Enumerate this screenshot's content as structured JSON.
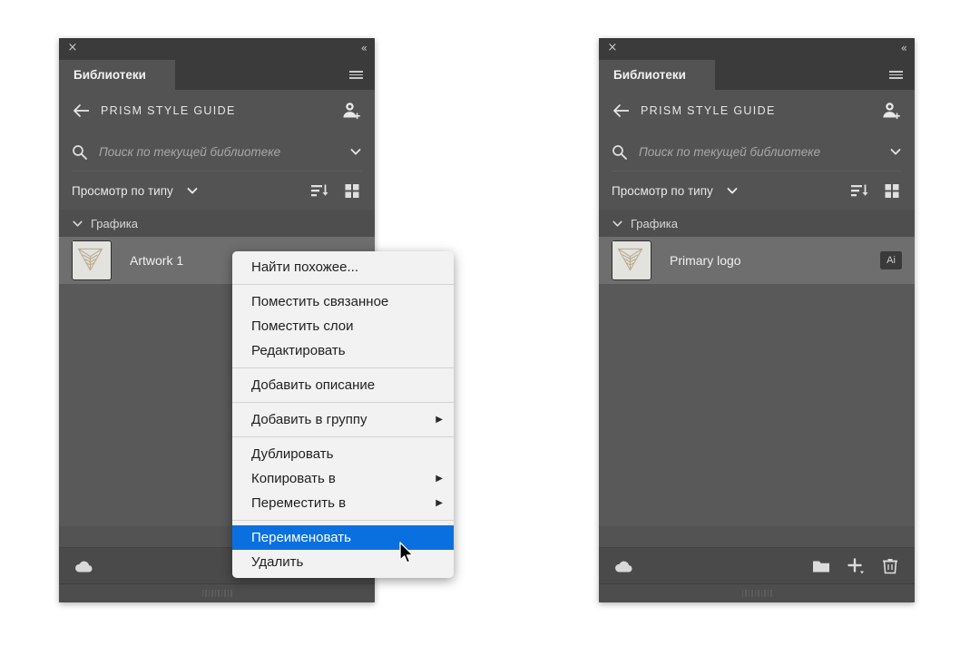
{
  "panels": {
    "left": {
      "titlebar": {
        "close": "×",
        "collapse": "«"
      },
      "tab": {
        "label": "Библиотеки",
        "menu_icon": "hamburger-icon"
      },
      "breadcrumb": {
        "back_icon": "back-arrow-icon",
        "title": "PRISM STYLE GUIDE",
        "invite_icon": "invite-person-icon"
      },
      "search": {
        "icon": "search-icon",
        "value": "",
        "placeholder": "Поиск по текущей библиотеке",
        "caret_icon": "chevron-down-icon"
      },
      "filter": {
        "label": "Просмотр по типу",
        "caret_icon": "chevron-down-icon",
        "sort_icon": "sort-descending-icon",
        "grid_icon": "grid-view-icon"
      },
      "group": {
        "label": "Графика",
        "chevron_icon": "chevron-down-icon"
      },
      "asset": {
        "name": "Artwork 1",
        "thumb_icon": "logo-thumbnail",
        "badge": ""
      },
      "bottom": {
        "cloud_icon": "cloud-sync-icon",
        "folder_icon": "new-folder-icon",
        "add_icon": "add-element-icon",
        "trash_icon": "delete-icon"
      }
    },
    "right": {
      "titlebar": {
        "close": "×",
        "collapse": "«"
      },
      "tab": {
        "label": "Библиотеки",
        "menu_icon": "hamburger-icon"
      },
      "breadcrumb": {
        "back_icon": "back-arrow-icon",
        "title": "PRISM STYLE GUIDE",
        "invite_icon": "invite-person-icon"
      },
      "search": {
        "icon": "search-icon",
        "value": "",
        "placeholder": "Поиск по текущей библиотеке",
        "caret_icon": "chevron-down-icon"
      },
      "filter": {
        "label": "Просмотр по типу",
        "caret_icon": "chevron-down-icon",
        "sort_icon": "sort-descending-icon",
        "grid_icon": "grid-view-icon"
      },
      "group": {
        "label": "Графика",
        "chevron_icon": "chevron-down-icon"
      },
      "asset": {
        "name": "Primary logo",
        "thumb_icon": "logo-thumbnail",
        "badge": "Ai"
      },
      "bottom": {
        "cloud_icon": "cloud-sync-icon",
        "folder_icon": "new-folder-icon",
        "add_icon": "add-element-icon",
        "trash_icon": "delete-icon"
      }
    }
  },
  "context_menu": {
    "items": [
      {
        "label": "Найти похожее...",
        "submenu": false,
        "highlighted": false
      },
      {
        "label": "Поместить связанное",
        "submenu": false,
        "highlighted": false
      },
      {
        "label": "Поместить слои",
        "submenu": false,
        "highlighted": false
      },
      {
        "label": "Редактировать",
        "submenu": false,
        "highlighted": false
      },
      {
        "label": "Добавить описание",
        "submenu": false,
        "highlighted": false
      },
      {
        "label": "Добавить в группу",
        "submenu": true,
        "highlighted": false
      },
      {
        "label": "Дублировать",
        "submenu": false,
        "highlighted": false
      },
      {
        "label": "Копировать  в",
        "submenu": true,
        "highlighted": false
      },
      {
        "label": "Переместить  в",
        "submenu": true,
        "highlighted": false
      },
      {
        "label": "Переименовать",
        "submenu": false,
        "highlighted": true
      },
      {
        "label": "Удалить",
        "submenu": false,
        "highlighted": false
      }
    ],
    "submenu_arrow": "▶",
    "highlight_color": "#0a70e0"
  },
  "cursor": {
    "icon": "mouse-pointer-icon"
  },
  "colors": {
    "panel_bg": "#535353",
    "titlebar_bg": "#3b3b3b",
    "content_bg": "#595959",
    "group_header_bg": "#4e4e4e",
    "selected_row_bg": "#6e6e6e",
    "menu_bg": "#f2f2f2",
    "accent": "#0a70e0",
    "logo_gold": "#b9a98c"
  }
}
